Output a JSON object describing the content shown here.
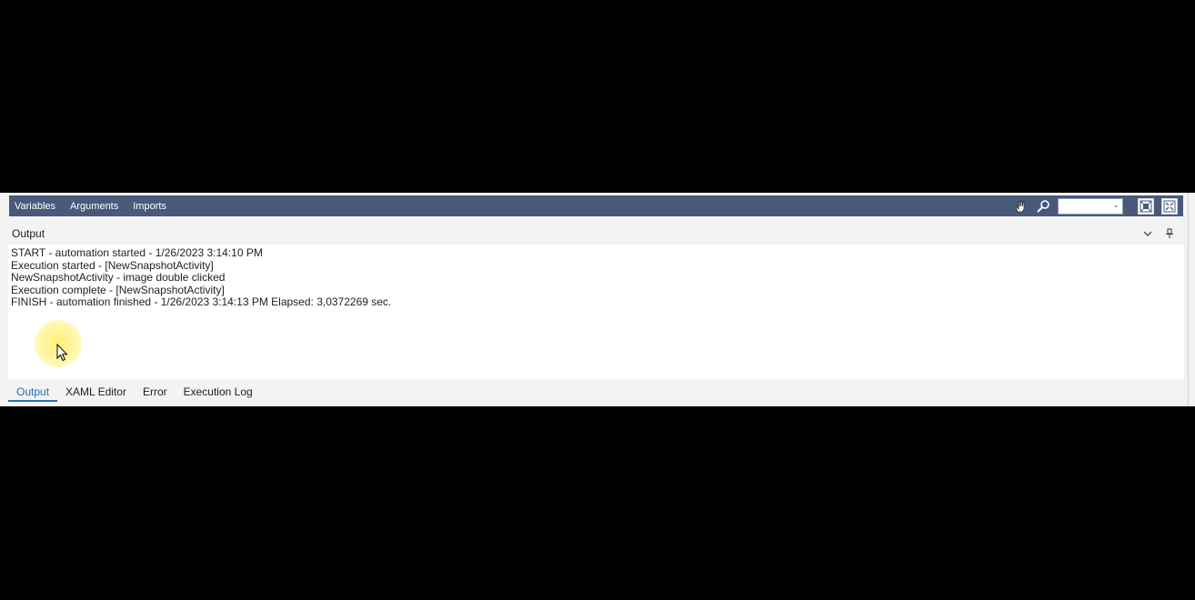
{
  "toolbar": {
    "variables": "Variables",
    "arguments": "Arguments",
    "imports": "Imports",
    "zoom_value": ""
  },
  "panel": {
    "title": "Output"
  },
  "log": [
    "START - automation started - 1/26/2023 3:14:10 PM",
    "Execution started - [NewSnapshotActivity]",
    "NewSnapshotActivity - image double clicked",
    "Execution complete - [NewSnapshotActivity]",
    "FINISH - automation finished - 1/26/2023 3:14:13 PM Elapsed: 3,0372269 sec."
  ],
  "tabs": [
    {
      "label": "Output",
      "active": true
    },
    {
      "label": "XAML Editor",
      "active": false
    },
    {
      "label": "Error",
      "active": false
    },
    {
      "label": "Execution Log",
      "active": false
    }
  ],
  "colors": {
    "toolbar_bg": "#48597a",
    "accent": "#2b6cb8"
  },
  "icons": {
    "pan": "hand-icon",
    "search": "magnifier-icon",
    "fit": "fit-to-screen-icon",
    "reset": "reset-zoom-icon",
    "collapse": "chevron-down-icon",
    "pin": "pin-icon"
  }
}
